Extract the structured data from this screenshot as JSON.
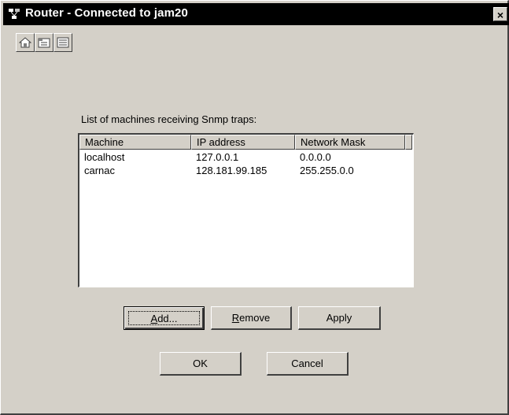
{
  "window": {
    "title": "Router - Connected to jam20",
    "title_icon": "network-router-icon",
    "close_glyph": "×"
  },
  "toolbar": {
    "buttons": [
      {
        "icon": "home-icon"
      },
      {
        "icon": "properties-icon"
      },
      {
        "icon": "list-view-icon"
      }
    ]
  },
  "list": {
    "label": "List of machines receiving Snmp traps:",
    "columns": [
      "Machine",
      "IP address",
      "Network Mask"
    ],
    "rows": [
      [
        "localhost",
        "127.0.0.1",
        "0.0.0.0"
      ],
      [
        "carnac",
        "128.181.99.185",
        "255.255.0.0"
      ]
    ]
  },
  "buttons": {
    "add": {
      "label": "Add...",
      "mnemonic": "A",
      "rest": "dd..."
    },
    "remove": {
      "label": "Remove",
      "mnemonic": "R",
      "rest": "emove"
    },
    "apply": "Apply",
    "ok": "OK",
    "cancel": "Cancel"
  },
  "colors": {
    "face": "#d4d0c8",
    "titlebar": "#000000",
    "list_bg": "#ffffff"
  }
}
